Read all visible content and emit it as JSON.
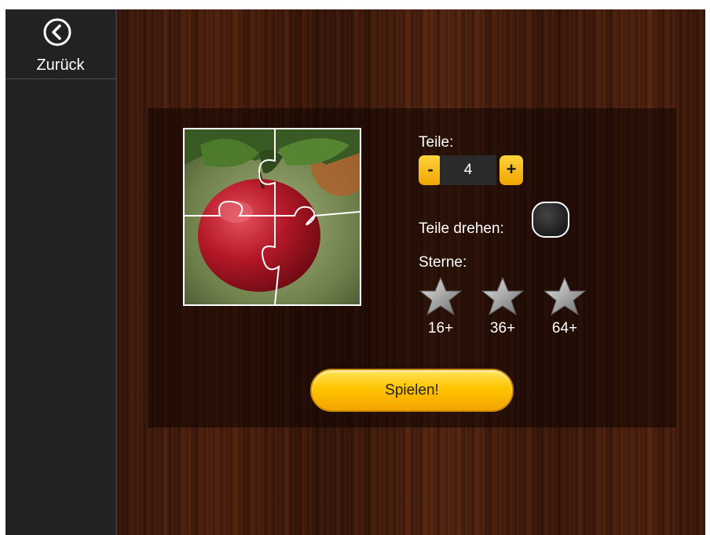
{
  "sidebar": {
    "back_label": "Zurück",
    "back_icon": "chevron-left-circle-icon"
  },
  "puzzle_preview": {
    "image": "red apple on branch",
    "icon": "apple-photo"
  },
  "settings": {
    "pieces_label": "Teile:",
    "pieces_minus": "-",
    "pieces_value": "4",
    "pieces_plus": "+",
    "rotate_label": "Teile drehen:",
    "rotate_enabled": false,
    "stars_label": "Sterne:",
    "stars": [
      {
        "label": "16+",
        "icon": "silver-star-icon"
      },
      {
        "label": "36+",
        "icon": "silver-star-icon"
      },
      {
        "label": "64+",
        "icon": "silver-star-icon"
      }
    ]
  },
  "play_label": "Spielen!",
  "colors": {
    "accent": "#ffc400",
    "sidebar": "#222222",
    "wood": "#4a1f0d"
  }
}
